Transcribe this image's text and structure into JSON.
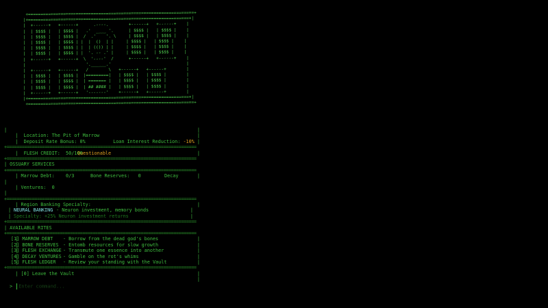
{
  "ascii_art": "  +==================================================================+\n |+================================================================+|\n |  +------+   +------+      .----.        +------+   +------+    |\n |  | $$$$ |   | $$$$ |   .'  ____ '.      | $$$$ |   | $$$$ |    |\n |  | $$$$ |   | $$$$ |  /  .'    '. \\     | $$$$ |   | $$$$ |    |\n |  | $$$$ |   | $$$$ | |  |  ()  | |     | $$$$ |   | $$$$ |    |\n |  | $$$$ |   | $$$$ | |  | (()) | |     | $$$$ |   | $$$$ |    |\n |  | $$$$ |   | $$$$ | |  '. -- .' |     | $$$$ |   | $$$$ |    |\n |  +------+   +------+  \\  '----'  /      +------+   +------+    |\n |                        '.______.'                              |\n |  +------+   +------+   /        \\   +------+   +------+        |\n |  | $$$$ |   | $$$$ |  |=========|   | $$$$ |   | $$$$ |        |\n |  | $$$$ |   | $$$$ |  | ======= |   | $$$$ |   | $$$$ |        |\n |  | $$$$ |   | $$$$ |  | ## #### |   | $$$$ |   | $$$$ |        |\n |  +------+   +------+   '-------'    +------+   +------+        |\n |+================================================================+|\n  +==================================================================+",
  "location_line": "|  Location: The Pit of Marrow",
  "deposit_line": "|  Deposit Rate Bonus: 0%",
  "loan_label": "Loan Interest Reduction: ",
  "loan_value": "-10%",
  "loan_end": " |",
  "flesh_label": "|  FLESH CREDIT:  50/100 - ",
  "flesh_status": "Questionable",
  "ossuary_title": "| OSSUARY SERVICES",
  "marrow_debt": "| Marrow Debt:    0/3",
  "bone_reserves": "Bone Reserves:   0",
  "decay": "Decay",
  "ventures": "| Ventures:  0",
  "specialty_title": "| Region Banking Specialty:",
  "specialty_name": "NEURAL BANKING",
  "specialty_desc": " - Neuron investment, memory bonds",
  "specialty_effect": "Specialty: +25% Neuron investment returns",
  "rites_title": "| AVAILABLE RITES",
  "rites": [
    {
      "key": "[1] MARROW DEBT ",
      "desc": "- Borrow from the dead god's bones"
    },
    {
      "key": "[2] BONE RESERVES",
      "desc": "- Entomb resources for slow growth"
    },
    {
      "key": "[3] FLESH EXCHANGE",
      "desc": "- Transmute one essence into another"
    },
    {
      "key": "[4] DECAY VENTURES",
      "desc": "- Gamble on the rot's whims"
    },
    {
      "key": "[5] FLESH LEDGER",
      "desc": "- Review your standing with the Vault"
    }
  ],
  "leave": "| [0] Leave the Vault",
  "prompt_symbol": ">",
  "input_placeholder": "Enter command..."
}
